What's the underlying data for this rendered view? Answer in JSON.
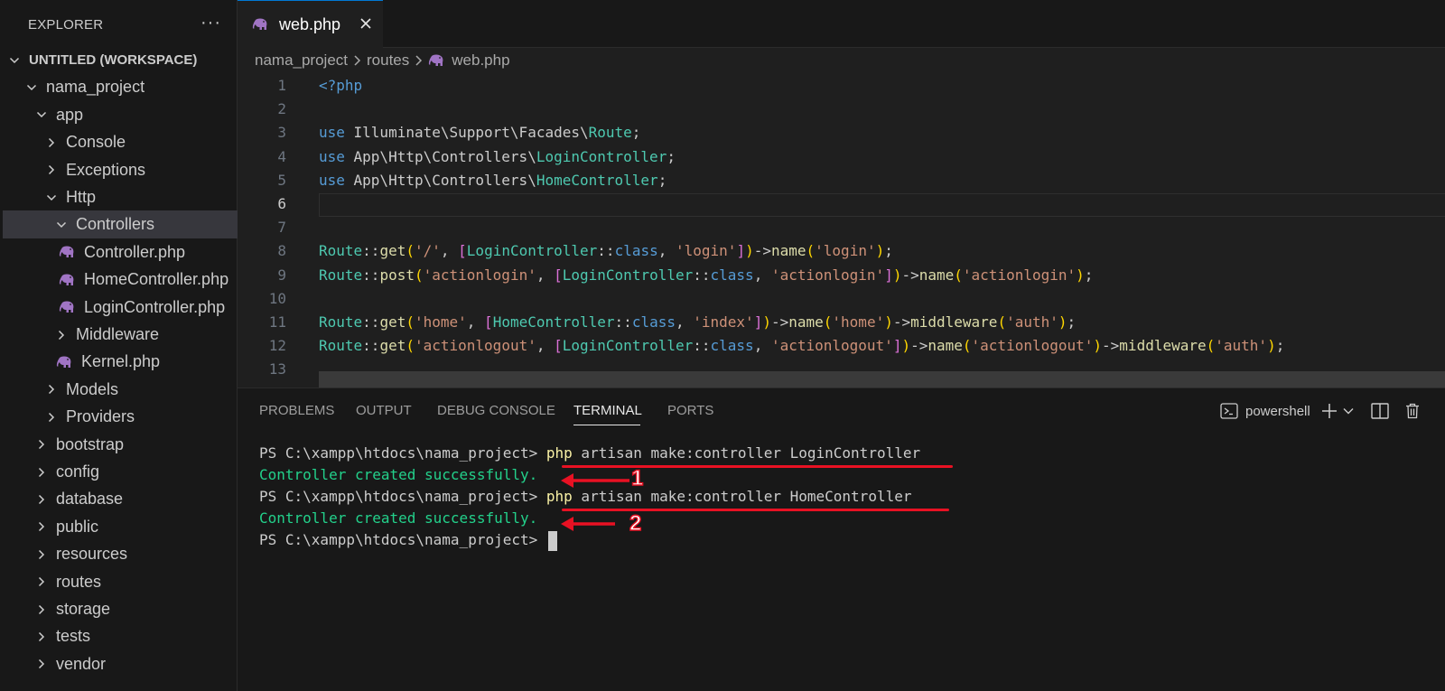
{
  "explorer": {
    "title": "EXPLORER",
    "more_icon": "ellipsis-icon",
    "tree": [
      {
        "label": "UNTITLED (WORKSPACE)",
        "kind": "root",
        "expanded": true,
        "indent": 0
      },
      {
        "label": "nama_project",
        "kind": "folder",
        "expanded": true,
        "indent": 1
      },
      {
        "label": "app",
        "kind": "folder",
        "expanded": true,
        "indent": 2
      },
      {
        "label": "Console",
        "kind": "folder",
        "expanded": false,
        "indent": 3
      },
      {
        "label": "Exceptions",
        "kind": "folder",
        "expanded": false,
        "indent": 3
      },
      {
        "label": "Http",
        "kind": "folder",
        "expanded": true,
        "indent": 3
      },
      {
        "label": "Controllers",
        "kind": "folder",
        "expanded": true,
        "indent": 4,
        "selected": true
      },
      {
        "label": "Controller.php",
        "kind": "php",
        "indent": 5
      },
      {
        "label": "HomeController.php",
        "kind": "php",
        "indent": 5
      },
      {
        "label": "LoginController.php",
        "kind": "php",
        "indent": 5
      },
      {
        "label": "Middleware",
        "kind": "folder",
        "expanded": false,
        "indent": 4
      },
      {
        "label": "Kernel.php",
        "kind": "php",
        "indent": 4
      },
      {
        "label": "Models",
        "kind": "folder",
        "expanded": false,
        "indent": 3
      },
      {
        "label": "Providers",
        "kind": "folder",
        "expanded": false,
        "indent": 3
      },
      {
        "label": "bootstrap",
        "kind": "folder",
        "expanded": false,
        "indent": 2
      },
      {
        "label": "config",
        "kind": "folder",
        "expanded": false,
        "indent": 2
      },
      {
        "label": "database",
        "kind": "folder",
        "expanded": false,
        "indent": 2
      },
      {
        "label": "public",
        "kind": "folder",
        "expanded": false,
        "indent": 2
      },
      {
        "label": "resources",
        "kind": "folder",
        "expanded": false,
        "indent": 2
      },
      {
        "label": "routes",
        "kind": "folder",
        "expanded": false,
        "indent": 2
      },
      {
        "label": "storage",
        "kind": "folder",
        "expanded": false,
        "indent": 2
      },
      {
        "label": "tests",
        "kind": "folder",
        "expanded": false,
        "indent": 2
      },
      {
        "label": "vendor",
        "kind": "folder",
        "expanded": false,
        "indent": 2
      }
    ]
  },
  "tabs": [
    {
      "label": "web.php",
      "icon": "php-elephant-icon",
      "active": true,
      "close_icon": "close-icon"
    }
  ],
  "breadcrumb": {
    "items": [
      "nama_project",
      "routes",
      "web.php"
    ]
  },
  "editor": {
    "active_line": 6,
    "lines": [
      {
        "n": "1",
        "tokens": [
          [
            "tag",
            "<?php"
          ]
        ]
      },
      {
        "n": "2",
        "tokens": []
      },
      {
        "n": "3",
        "tokens": [
          [
            "kw",
            "use "
          ],
          [
            "ns",
            "Illuminate\\Support\\Facades\\"
          ],
          [
            "cls",
            "Route"
          ],
          [
            "op",
            ";"
          ]
        ]
      },
      {
        "n": "4",
        "tokens": [
          [
            "kw",
            "use "
          ],
          [
            "ns",
            "App\\Http\\Controllers\\"
          ],
          [
            "cls",
            "LoginController"
          ],
          [
            "op",
            ";"
          ]
        ]
      },
      {
        "n": "5",
        "tokens": [
          [
            "kw",
            "use "
          ],
          [
            "ns",
            "App\\Http\\Controllers\\"
          ],
          [
            "cls",
            "HomeController"
          ],
          [
            "op",
            ";"
          ]
        ]
      },
      {
        "n": "6",
        "tokens": []
      },
      {
        "n": "7",
        "tokens": []
      },
      {
        "n": "8",
        "tokens": [
          [
            "cls",
            "Route"
          ],
          [
            "op",
            "::"
          ],
          [
            "fn",
            "get"
          ],
          [
            "br1",
            "("
          ],
          [
            "str",
            "'/'"
          ],
          [
            "op",
            ", "
          ],
          [
            "br2",
            "["
          ],
          [
            "cls",
            "LoginController"
          ],
          [
            "op",
            "::"
          ],
          [
            "kw",
            "class"
          ],
          [
            "op",
            ", "
          ],
          [
            "str",
            "'login'"
          ],
          [
            "br2",
            "]"
          ],
          [
            "br1",
            ")"
          ],
          [
            "op",
            "->"
          ],
          [
            "fn",
            "name"
          ],
          [
            "br1",
            "("
          ],
          [
            "str",
            "'login'"
          ],
          [
            "br1",
            ")"
          ],
          [
            "op",
            ";"
          ]
        ]
      },
      {
        "n": "9",
        "tokens": [
          [
            "cls",
            "Route"
          ],
          [
            "op",
            "::"
          ],
          [
            "fn",
            "post"
          ],
          [
            "br1",
            "("
          ],
          [
            "str",
            "'actionlogin'"
          ],
          [
            "op",
            ", "
          ],
          [
            "br2",
            "["
          ],
          [
            "cls",
            "LoginController"
          ],
          [
            "op",
            "::"
          ],
          [
            "kw",
            "class"
          ],
          [
            "op",
            ", "
          ],
          [
            "str",
            "'actionlogin'"
          ],
          [
            "br2",
            "]"
          ],
          [
            "br1",
            ")"
          ],
          [
            "op",
            "->"
          ],
          [
            "fn",
            "name"
          ],
          [
            "br1",
            "("
          ],
          [
            "str",
            "'actionlogin'"
          ],
          [
            "br1",
            ")"
          ],
          [
            "op",
            ";"
          ]
        ]
      },
      {
        "n": "10",
        "tokens": []
      },
      {
        "n": "11",
        "tokens": [
          [
            "cls",
            "Route"
          ],
          [
            "op",
            "::"
          ],
          [
            "fn",
            "get"
          ],
          [
            "br1",
            "("
          ],
          [
            "str",
            "'home'"
          ],
          [
            "op",
            ", "
          ],
          [
            "br2",
            "["
          ],
          [
            "cls",
            "HomeController"
          ],
          [
            "op",
            "::"
          ],
          [
            "kw",
            "class"
          ],
          [
            "op",
            ", "
          ],
          [
            "str",
            "'index'"
          ],
          [
            "br2",
            "]"
          ],
          [
            "br1",
            ")"
          ],
          [
            "op",
            "->"
          ],
          [
            "fn",
            "name"
          ],
          [
            "br1",
            "("
          ],
          [
            "str",
            "'home'"
          ],
          [
            "br1",
            ")"
          ],
          [
            "op",
            "->"
          ],
          [
            "fn",
            "middleware"
          ],
          [
            "br1",
            "("
          ],
          [
            "str",
            "'auth'"
          ],
          [
            "br1",
            ")"
          ],
          [
            "op",
            ";"
          ]
        ]
      },
      {
        "n": "12",
        "tokens": [
          [
            "cls",
            "Route"
          ],
          [
            "op",
            "::"
          ],
          [
            "fn",
            "get"
          ],
          [
            "br1",
            "("
          ],
          [
            "str",
            "'actionlogout'"
          ],
          [
            "op",
            ", "
          ],
          [
            "br2",
            "["
          ],
          [
            "cls",
            "LoginController"
          ],
          [
            "op",
            "::"
          ],
          [
            "kw",
            "class"
          ],
          [
            "op",
            ", "
          ],
          [
            "str",
            "'actionlogout'"
          ],
          [
            "br2",
            "]"
          ],
          [
            "br1",
            ")"
          ],
          [
            "op",
            "->"
          ],
          [
            "fn",
            "name"
          ],
          [
            "br1",
            "("
          ],
          [
            "str",
            "'actionlogout'"
          ],
          [
            "br1",
            ")"
          ],
          [
            "op",
            "->"
          ],
          [
            "fn",
            "middleware"
          ],
          [
            "br1",
            "("
          ],
          [
            "str",
            "'auth'"
          ],
          [
            "br1",
            ")"
          ],
          [
            "op",
            ";"
          ]
        ]
      },
      {
        "n": "13",
        "tokens": []
      }
    ]
  },
  "panel": {
    "tabs": [
      "PROBLEMS",
      "OUTPUT",
      "DEBUG CONSOLE",
      "TERMINAL",
      "PORTS"
    ],
    "active_tab": "TERMINAL",
    "profile_label": "powershell",
    "profile_icon": "terminal-icon",
    "actions": [
      "plus-icon",
      "chevron-down-icon",
      "split-icon",
      "trash-icon"
    ]
  },
  "terminal": {
    "lines": [
      {
        "prompt": "PS C:\\xampp\\htdocs\\nama_project> ",
        "cmd_head": "php",
        "cmd_rest": " artisan make:controller LoginController"
      },
      {
        "output": "Controller created successfully."
      },
      {
        "prompt": "PS C:\\xampp\\htdocs\\nama_project> ",
        "cmd_head": "php",
        "cmd_rest": " artisan make:controller HomeController"
      },
      {
        "output": "Controller created successfully."
      },
      {
        "prompt": "PS C:\\xampp\\htdocs\\nama_project> ",
        "cursor": true
      }
    ]
  },
  "annotations": {
    "numbers": [
      "1",
      "2"
    ],
    "color": "#e81123"
  },
  "colors": {
    "accent": "#0078d4",
    "php_icon": "#a074c4",
    "success": "#23d18b"
  }
}
